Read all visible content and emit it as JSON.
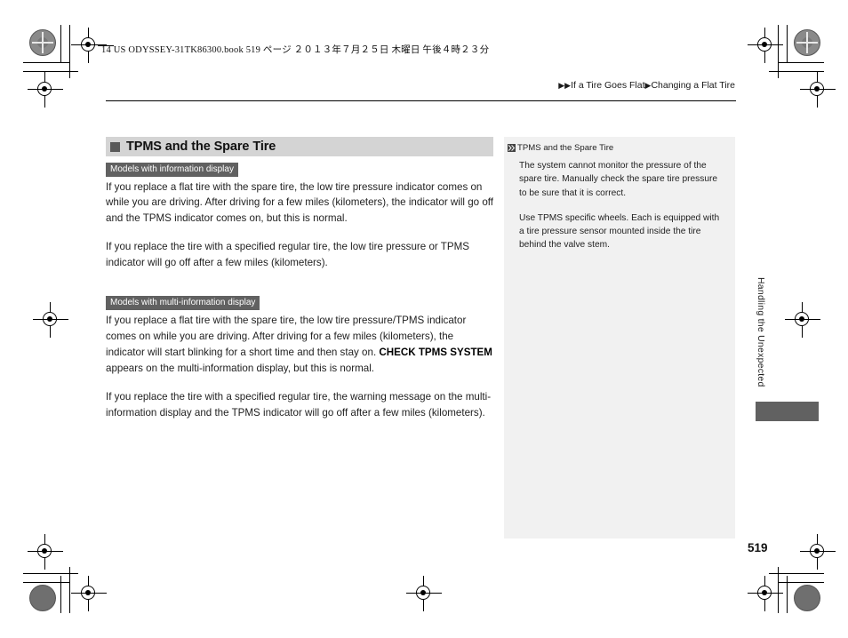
{
  "print_header": {
    "file_info": "14 US ODYSSEY-31TK86300.book   519 ページ   ２０１３年７月２５日   木曜日   午後４時２３分"
  },
  "breadcrumb": {
    "arrow_double": "▶▶",
    "arrow_single": "▶",
    "level1": "If a Tire Goes Flat",
    "level2": "Changing a Flat Tire"
  },
  "section": {
    "title": "TPMS and the Spare Tire",
    "bullet_icon": "filled-square-icon"
  },
  "main": {
    "tag1": "Models with information display",
    "p1": "If you replace a flat tire with the spare tire, the low tire pressure indicator comes on while you are driving. After driving for a few miles (kilometers), the indicator will go off and the TPMS indicator comes on, but this is normal.",
    "p2": "If you replace the tire with a specified regular tire, the low tire pressure or TPMS indicator will go off after a few miles (kilometers).",
    "tag2": "Models with multi-information display",
    "p3_a": "If you replace a flat tire with the spare tire, the low tire pressure/TPMS indicator comes on while you are driving. After driving for a few miles (kilometers), the indicator will start blinking for a short time and then stay on. ",
    "p3_bold": "CHECK TPMS SYSTEM",
    "p3_b": " appears on the multi-information display, but this is normal.",
    "p4": "If you replace the tire with a specified regular tire, the warning message on the multi-information display and the TPMS indicator will go off after a few miles (kilometers)."
  },
  "note_panel": {
    "head_icon": "double-chevron-right-icon",
    "head_title": "TPMS and the Spare Tire",
    "p1": "The system cannot monitor the pressure of the spare tire. Manually check the spare tire pressure to be sure that it is correct.",
    "p2": "Use TPMS specific wheels. Each is equipped with a tire pressure sensor mounted inside the tire behind the valve stem."
  },
  "side_tab": {
    "chapter": "Handling the Unexpected"
  },
  "footer": {
    "page_number": "519"
  },
  "colors": {
    "heading_band": "#d4d4d4",
    "tag_background": "#616161",
    "note_panel": "#f1f1f1",
    "side_tab": "#616161",
    "text": "#1f1f1f"
  }
}
